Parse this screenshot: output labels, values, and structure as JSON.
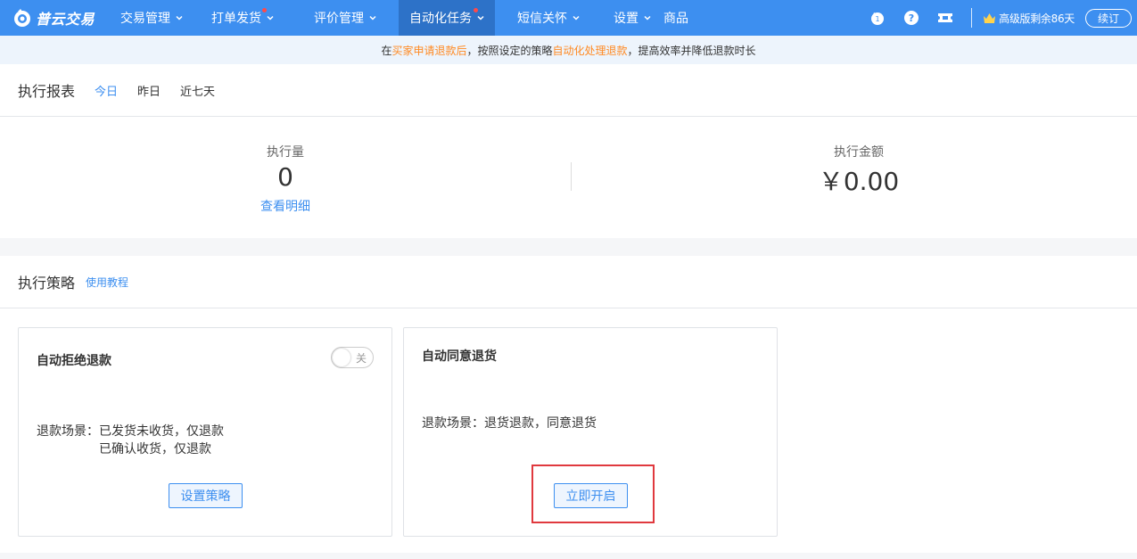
{
  "brand": {
    "name": "普云交易"
  },
  "nav": {
    "items": [
      {
        "label": "交易管理",
        "has_caret": true,
        "dot": false,
        "active": false
      },
      {
        "label": "打单发货",
        "has_caret": true,
        "dot": true,
        "active": false
      },
      {
        "label": "评价管理",
        "has_caret": true,
        "dot": false,
        "active": false
      },
      {
        "label": "自动化任务",
        "has_caret": true,
        "dot": true,
        "active": true
      },
      {
        "label": "短信关怀",
        "has_caret": true,
        "dot": false,
        "active": false
      },
      {
        "label": "设置",
        "has_caret": true,
        "dot": false,
        "active": false
      },
      {
        "label": "商品",
        "has_caret": false,
        "dot": false,
        "active": false
      }
    ],
    "tools": [
      "notification-icon",
      "help-icon",
      "ticket-icon"
    ],
    "plan_text": "高级版剩余86天",
    "renew_label": "续订"
  },
  "notice": {
    "prefix": "在",
    "hl1": "买家申请退款后",
    "middle": "，按照设定的策略",
    "hl2": "自动化处理退款",
    "suffix": "，提高效率并降低退款时长"
  },
  "report": {
    "title": "执行报表",
    "tabs": [
      {
        "label": "今日",
        "active": true
      },
      {
        "label": "昨日",
        "active": false
      },
      {
        "label": "近七天",
        "active": false
      }
    ],
    "count_label": "执行量",
    "count_value": "0",
    "detail_link": "查看明细",
    "amount_label": "执行金额",
    "amount_value": "￥0.00"
  },
  "strategy": {
    "title": "执行策略",
    "tutorial_link": "使用教程",
    "cards": [
      {
        "title": "自动拒绝退款",
        "toggle_label": "关",
        "toggle_on": false,
        "scene_prefix": "退款场景：",
        "scene_line1": "已发货未收货，仅退款",
        "scene_line2": "已确认收货，仅退款",
        "button": "设置策略"
      },
      {
        "title": "自动同意退货",
        "scene_prefix": "退款场景：",
        "scene_line1": "退货退款，同意退货",
        "button": "立即开启"
      }
    ]
  },
  "colors": {
    "primary": "#3d8ff0",
    "nav_active": "#2d72c8",
    "highlight_orange": "#ff8a23",
    "annotation_red": "#e0393e"
  }
}
